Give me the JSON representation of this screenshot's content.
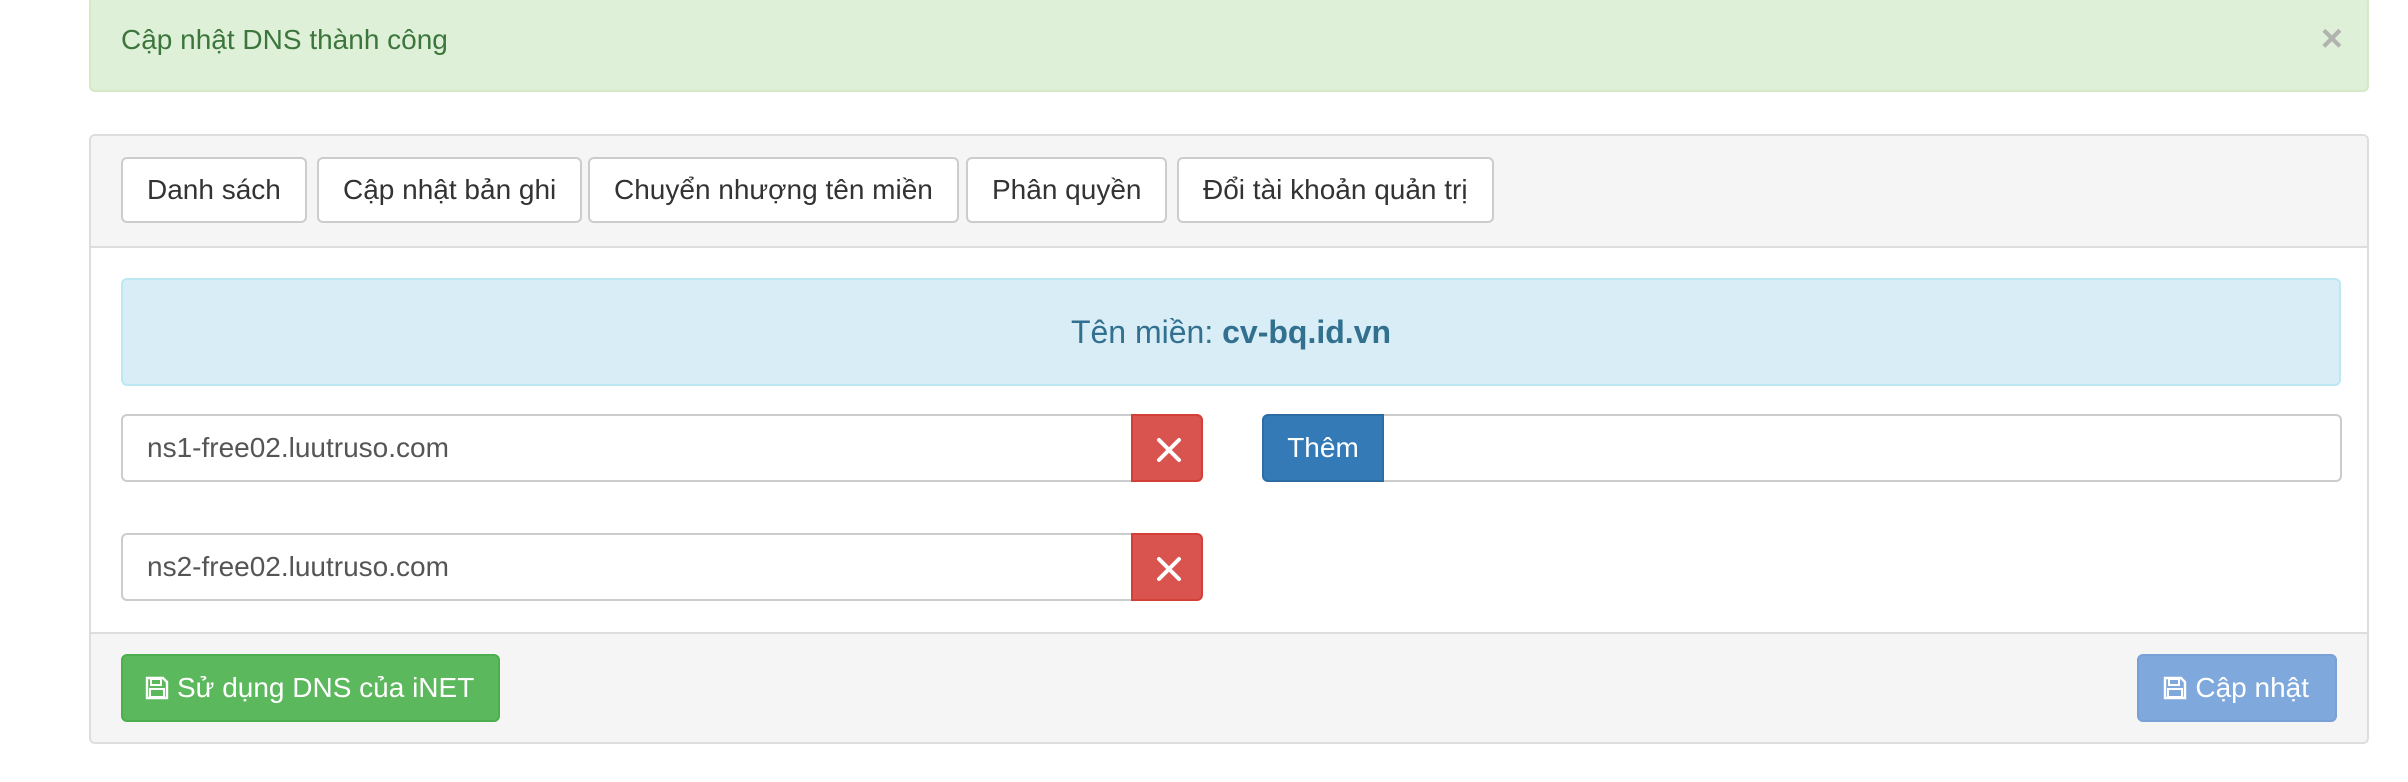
{
  "alert": {
    "message": "Cập nhật DNS thành công",
    "close_symbol": "×",
    "bg_color": "#dff0d8",
    "text_color": "#3c763d"
  },
  "tabs": [
    {
      "label": "Danh sách"
    },
    {
      "label": "Cập nhật bản ghi"
    },
    {
      "label": "Chuyển nhượng tên miền"
    },
    {
      "label": "Phân quyền"
    },
    {
      "label": "Đổi tài khoản quản trị"
    }
  ],
  "domain_info": {
    "label": "Tên miền: ",
    "domain": "cv-bq.id.vn"
  },
  "nameservers": [
    {
      "value": "ns1-free02.luutruso.com",
      "remove_icon": "close-icon"
    },
    {
      "value": "ns2-free02.luutruso.com",
      "remove_icon": "close-icon"
    }
  ],
  "add": {
    "button_label": "Thêm",
    "input_value": ""
  },
  "footer": {
    "use_inet_label": "Sử dụng DNS của iNET",
    "update_label": "Cập nhật",
    "icon": "floppy-disk-icon"
  },
  "colors": {
    "success": "#5cb85c",
    "danger": "#d9534f",
    "primary": "#337ab7",
    "primary_disabled": "#7fa8dc",
    "info_bg": "#d9edf7",
    "info_text": "#31708f"
  }
}
